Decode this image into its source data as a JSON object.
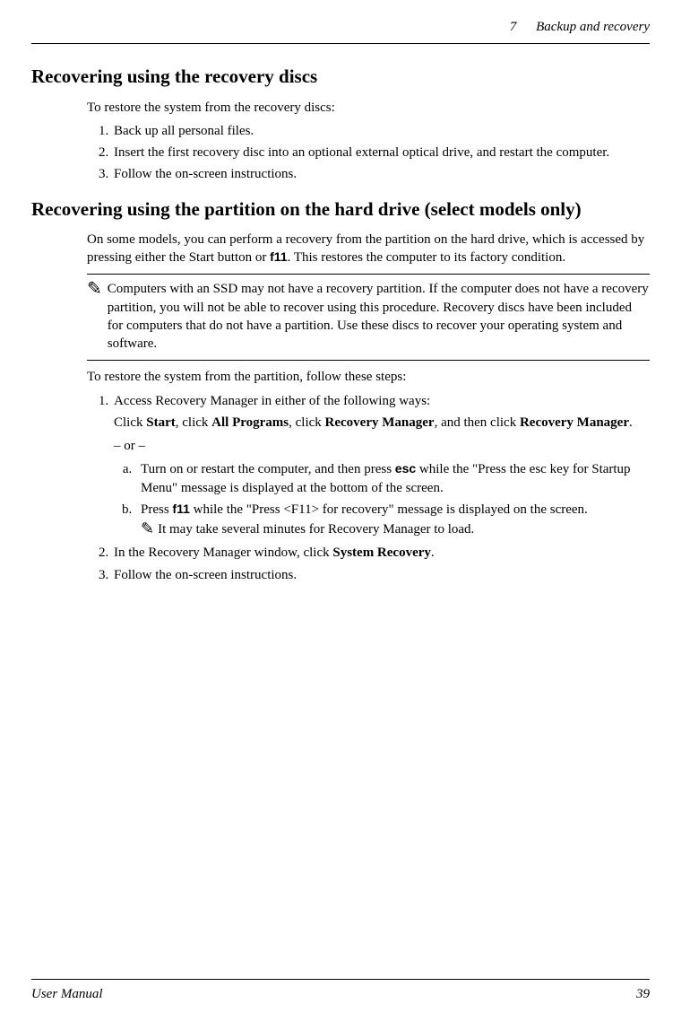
{
  "header": {
    "chapter_num": "7",
    "chapter_title": "Backup and recovery"
  },
  "section1": {
    "heading": "Recovering using the recovery discs",
    "intro": "To restore the system from the recovery discs:",
    "steps": {
      "s1": "Back up all personal files.",
      "s2": "Insert the first recovery disc into an optional external optical drive, and restart the computer.",
      "s3": "Follow the on-screen instructions."
    }
  },
  "section2": {
    "heading": "Recovering using the partition on the hard drive (select models only)",
    "intro_pre": "On some models, you can perform a recovery from the partition on the hard drive, which is accessed by pressing either the Start button or ",
    "intro_key": "f11",
    "intro_post": ". This restores the computer to its factory condition.",
    "note1": "Computers with an SSD may not have a recovery partition. If the computer does not have a recovery partition, you will not be able to recover using this procedure. Recovery discs have been included for computers that do not have a partition. Use these discs to recover your operating system and software.",
    "intro2": "To restore the system from the partition, follow these steps:",
    "step1_intro": "Access Recovery Manager in either of the following ways:",
    "step1_click_pre": "Click ",
    "step1_b1": "Start",
    "step1_mid1": ", click ",
    "step1_b2": "All Programs",
    "step1_mid2": ", click ",
    "step1_b3": "Recovery Manager",
    "step1_mid3": ", and then click ",
    "step1_b4": "Recovery Manager",
    "step1_end": ".",
    "or": "– or –",
    "step1a_pre": "Turn on or restart the computer, and then press ",
    "step1a_key": "esc",
    "step1a_post": " while the \"Press the esc key for Startup Menu\" message is displayed at the bottom of the screen.",
    "step1b_pre": "Press ",
    "step1b_key": "f11",
    "step1b_post": " while the \"Press <F11> for recovery\" message is displayed on the screen.",
    "step1b_note": "It may take several minutes for Recovery Manager to load.",
    "step2_pre": "In the Recovery Manager window, click ",
    "step2_b": "System Recovery",
    "step2_post": ".",
    "step3": "Follow the on-screen instructions."
  },
  "footer": {
    "left": "User Manual",
    "right": "39"
  }
}
